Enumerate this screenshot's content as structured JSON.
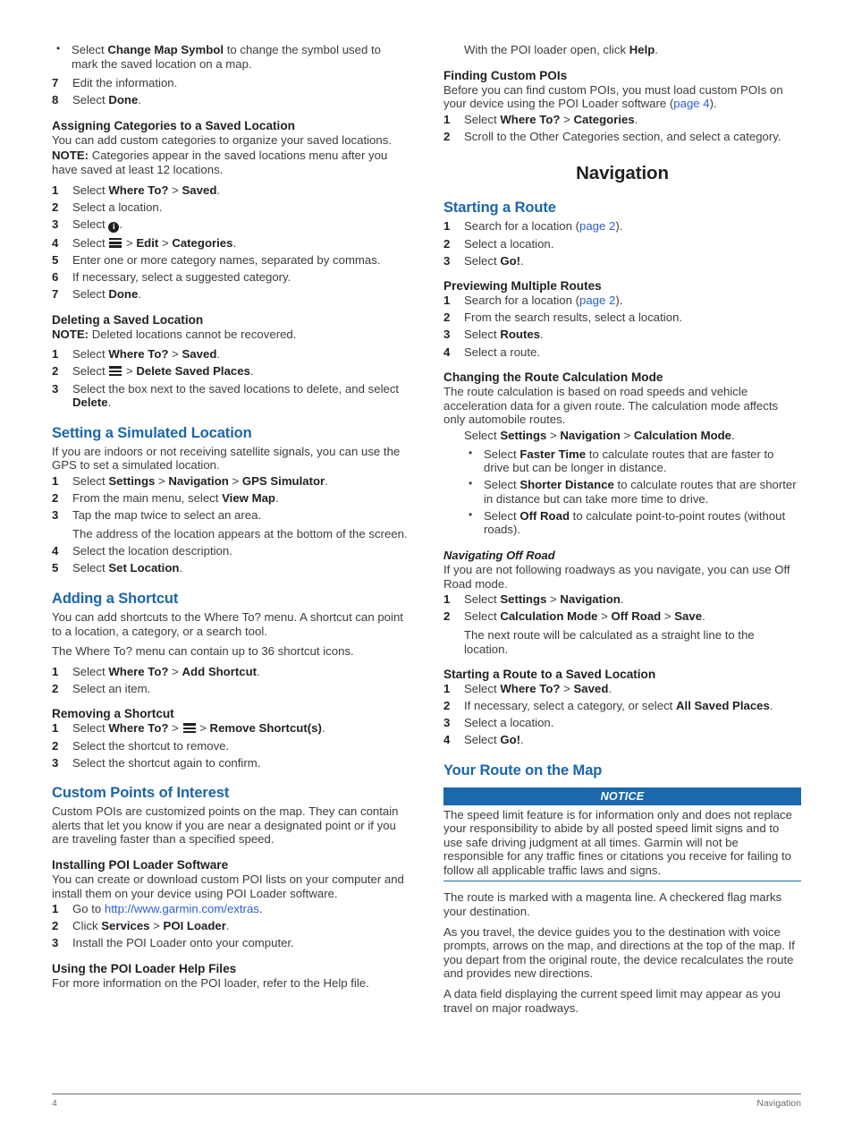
{
  "document": {
    "chapter_title": "Navigation",
    "footer": {
      "page_number": "4",
      "section": "Navigation"
    }
  },
  "colors": {
    "heading_blue": "#1b65a8",
    "notice_blue": "#1b68ad",
    "link_blue": "#2b5fd0",
    "body_text": "#3c3c3c"
  },
  "left_column": {
    "top_bullet": {
      "pre": "Select ",
      "bold": "Change Map Symbol",
      "post": " to change the symbol used to mark the saved location on a map."
    },
    "step7": {
      "num": "7",
      "text": "Edit the information."
    },
    "step8": {
      "num": "8",
      "pre": "Select ",
      "bold": "Done",
      "post": "."
    },
    "assigning": {
      "heading": "Assigning Categories to a Saved Location",
      "intro": "You can add custom categories to organize your saved locations.",
      "note_label": "NOTE:",
      "note_text": " Categories appear in the saved locations menu after you have saved at least 12 locations.",
      "steps": [
        {
          "num": "1",
          "pre": "Select ",
          "b1": "Where To?",
          "sep": " > ",
          "b2": "Saved",
          "post": "."
        },
        {
          "num": "2",
          "text": "Select a location."
        },
        {
          "num": "3",
          "pre": "Select ",
          "icon": "info-icon",
          "post": "."
        },
        {
          "num": "4",
          "pre": "Select ",
          "icon": "menu-icon",
          "sep1": " > ",
          "b1": "Edit",
          "sep2": " > ",
          "b2": "Categories",
          "post": "."
        },
        {
          "num": "5",
          "text": "Enter one or more category names, separated by commas."
        },
        {
          "num": "6",
          "text": "If necessary, select a suggested category."
        },
        {
          "num": "7",
          "pre": "Select ",
          "b1": "Done",
          "post": "."
        }
      ]
    },
    "deleting": {
      "heading": "Deleting a Saved Location",
      "note_label": "NOTE:",
      "note_text": " Deleted locations cannot be recovered.",
      "steps": [
        {
          "num": "1",
          "pre": "Select ",
          "b1": "Where To?",
          "sep": " > ",
          "b2": "Saved",
          "post": "."
        },
        {
          "num": "2",
          "pre": "Select ",
          "icon": "menu-icon",
          "sep1": " > ",
          "b1": "Delete Saved Places",
          "post": "."
        },
        {
          "num": "3",
          "pre": "Select the box next to the saved locations to delete, and select ",
          "b1": "Delete",
          "post": "."
        }
      ]
    },
    "simulated": {
      "heading": "Setting a Simulated Location",
      "intro": "If you are indoors or not receiving satellite signals, you can use the GPS to set a simulated location.",
      "steps": [
        {
          "num": "1",
          "pre": "Select ",
          "b1": "Settings",
          "sep1": " > ",
          "b2": "Navigation",
          "sep2": " > ",
          "b3": "GPS Simulator",
          "post": "."
        },
        {
          "num": "2",
          "pre": "From the main menu, select ",
          "b1": "View Map",
          "post": "."
        },
        {
          "num": "3",
          "text": "Tap the map twice to select an area."
        },
        {
          "num": "4",
          "text": "Select the location description."
        },
        {
          "num": "5",
          "pre": "Select ",
          "b1": "Set Location",
          "post": "."
        }
      ],
      "step3_note": "The address of the location appears at the bottom of the screen."
    },
    "shortcut": {
      "heading": "Adding a Shortcut",
      "p1": "You can add shortcuts to the Where To? menu. A shortcut can point to a location, a category, or a search tool.",
      "p2": "The Where To? menu can contain up to 36 shortcut icons.",
      "steps": [
        {
          "num": "1",
          "pre": "Select ",
          "b1": "Where To?",
          "sep1": " > ",
          "b2": "Add Shortcut",
          "post": "."
        },
        {
          "num": "2",
          "text": "Select an item."
        }
      ]
    },
    "removing_shortcut": {
      "heading": "Removing a Shortcut",
      "steps": [
        {
          "num": "1",
          "pre": "Select ",
          "b1": "Where To?",
          "sep1": " > ",
          "icon": "menu-icon",
          "sep2": " > ",
          "b2": "Remove Shortcut(s)",
          "post": "."
        },
        {
          "num": "2",
          "text": "Select the shortcut to remove."
        },
        {
          "num": "3",
          "text": "Select the shortcut again to confirm."
        }
      ]
    },
    "custom_poi": {
      "heading": "Custom Points of Interest",
      "intro": "Custom POIs are customized points on the map. They can contain alerts that let you know if you are near a designated point or if you are traveling faster than a specified speed."
    },
    "installing_poi": {
      "heading": "Installing POI Loader Software",
      "intro": "You can create or download custom POI lists on your computer and install them on your device using POI Loader software.",
      "steps": [
        {
          "num": "1",
          "pre": "Go to ",
          "link": "http://www.garmin.com/extras",
          "post": "."
        },
        {
          "num": "2",
          "pre": "Click ",
          "b1": "Services",
          "sep1": " > ",
          "b2": "POI Loader",
          "post": "."
        },
        {
          "num": "3",
          "text": "Install the POI Loader onto your computer."
        }
      ]
    },
    "using_poi_help": {
      "heading": "Using the POI Loader Help Files",
      "intro": "For more information on the POI loader, refer to the Help file."
    }
  },
  "right_column": {
    "help_line": {
      "pre": "With the POI loader open, click ",
      "b1": "Help",
      "post": "."
    },
    "finding_poi": {
      "heading": "Finding Custom POIs",
      "intro_pre": "Before you can find custom POIs, you must load custom POIs on your device using the POI Loader software (",
      "intro_link": "page 4",
      "intro_post": ").",
      "steps": [
        {
          "num": "1",
          "pre": "Select ",
          "b1": "Where To?",
          "sep1": " > ",
          "b2": "Categories",
          "post": "."
        },
        {
          "num": "2",
          "text": "Scroll to the Other Categories section, and select a category."
        }
      ]
    },
    "starting_route": {
      "heading": "Starting a Route",
      "steps": [
        {
          "num": "1",
          "pre": "Search for a location (",
          "link": "page 2",
          "post": ")."
        },
        {
          "num": "2",
          "text": "Select a location."
        },
        {
          "num": "3",
          "pre": "Select ",
          "b1": "Go!",
          "post": "."
        }
      ]
    },
    "previewing": {
      "heading": "Previewing Multiple Routes",
      "steps": [
        {
          "num": "1",
          "pre": "Search for a location (",
          "link": "page 2",
          "post": ")."
        },
        {
          "num": "2",
          "text": "From the search results, select a location."
        },
        {
          "num": "3",
          "pre": "Select ",
          "b1": "Routes",
          "post": "."
        },
        {
          "num": "4",
          "text": "Select a route."
        }
      ]
    },
    "calc_mode": {
      "heading": "Changing the Route Calculation Mode",
      "intro": "The route calculation is based on road speeds and vehicle acceleration data for a given route. The calculation mode affects only automobile routes.",
      "select_line": {
        "pre": "Select ",
        "b1": "Settings",
        "sep1": " > ",
        "b2": "Navigation",
        "sep2": " > ",
        "b3": "Calculation Mode",
        "post": "."
      },
      "bullets": [
        {
          "pre": "Select ",
          "b1": "Faster Time",
          "post": " to calculate routes that are faster to drive but can be longer in distance."
        },
        {
          "pre": "Select ",
          "b1": "Shorter Distance",
          "post": " to calculate routes that are shorter in distance but can take more time to drive."
        },
        {
          "pre": "Select ",
          "b1": "Off Road",
          "post": " to calculate point-to-point routes (without roads)."
        }
      ]
    },
    "off_road": {
      "heading": "Navigating Off Road",
      "intro": "If you are not following roadways as you navigate, you can use Off Road mode.",
      "steps": [
        {
          "num": "1",
          "pre": "Select ",
          "b1": "Settings",
          "sep1": " > ",
          "b2": "Navigation",
          "post": "."
        },
        {
          "num": "2",
          "pre": "Select ",
          "b1": "Calculation Mode",
          "sep1": " > ",
          "b2": "Off Road",
          "sep2": " > ",
          "b3": "Save",
          "post": "."
        }
      ],
      "step2_note": "The next route will be calculated as a straight line to the location."
    },
    "route_saved": {
      "heading": "Starting a Route to a Saved Location",
      "steps": [
        {
          "num": "1",
          "pre": "Select ",
          "b1": "Where To?",
          "sep1": " > ",
          "b2": "Saved",
          "post": "."
        },
        {
          "num": "2",
          "pre": "If necessary, select a category, or select ",
          "b1": "All Saved Places",
          "post": "."
        },
        {
          "num": "3",
          "text": "Select a location."
        },
        {
          "num": "4",
          "pre": "Select ",
          "b1": "Go!",
          "post": "."
        }
      ]
    },
    "route_on_map": {
      "heading": "Your Route on the Map",
      "notice_label": "NOTICE",
      "notice_body": "The speed limit feature is for information only and does not replace your responsibility to abide by all posted speed limit signs and to use safe driving judgment at all times. Garmin will not be responsible for any traffic fines or citations you receive for failing to follow all applicable traffic laws and signs.",
      "p1": "The route is marked with a magenta line. A checkered flag marks your destination.",
      "p2": "As you travel, the device guides you to the destination with voice prompts, arrows on the map, and directions at the top of the map. If you depart from the original route, the device recalculates the route and provides new directions.",
      "p3": "A data field displaying the current speed limit may appear as you travel on major roadways."
    }
  }
}
